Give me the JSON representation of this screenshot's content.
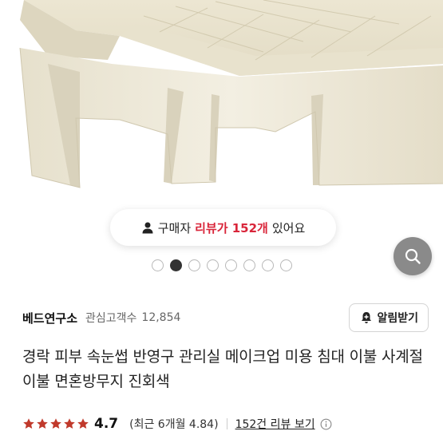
{
  "review_banner": {
    "prefix": "구매자",
    "highlight": "리뷰가 152개",
    "suffix": "있어요",
    "highlight_color": "#d9253a",
    "icon": "person-icon"
  },
  "carousel": {
    "total_slides": 8,
    "active_index": 1
  },
  "search_fab": {
    "icon": "search-icon"
  },
  "seller": {
    "name": "베드연구소",
    "meta_label": "관심고객수",
    "follower_count": "12,854",
    "alarm_button_label": "알림받기",
    "alarm_icon": "bell-plus-icon"
  },
  "product": {
    "title": "경락 피부 속눈썹 반영구 관리실 메이크업 미용 침대 이불 사계절이불 면혼방무지 진회색"
  },
  "rating": {
    "stars": 5,
    "star_color": "#c0392b",
    "value": "4.7",
    "recent_summary": "(최근 6개월 4.84)",
    "review_link": "152건 리뷰 보기",
    "info_icon": "info-icon"
  }
}
